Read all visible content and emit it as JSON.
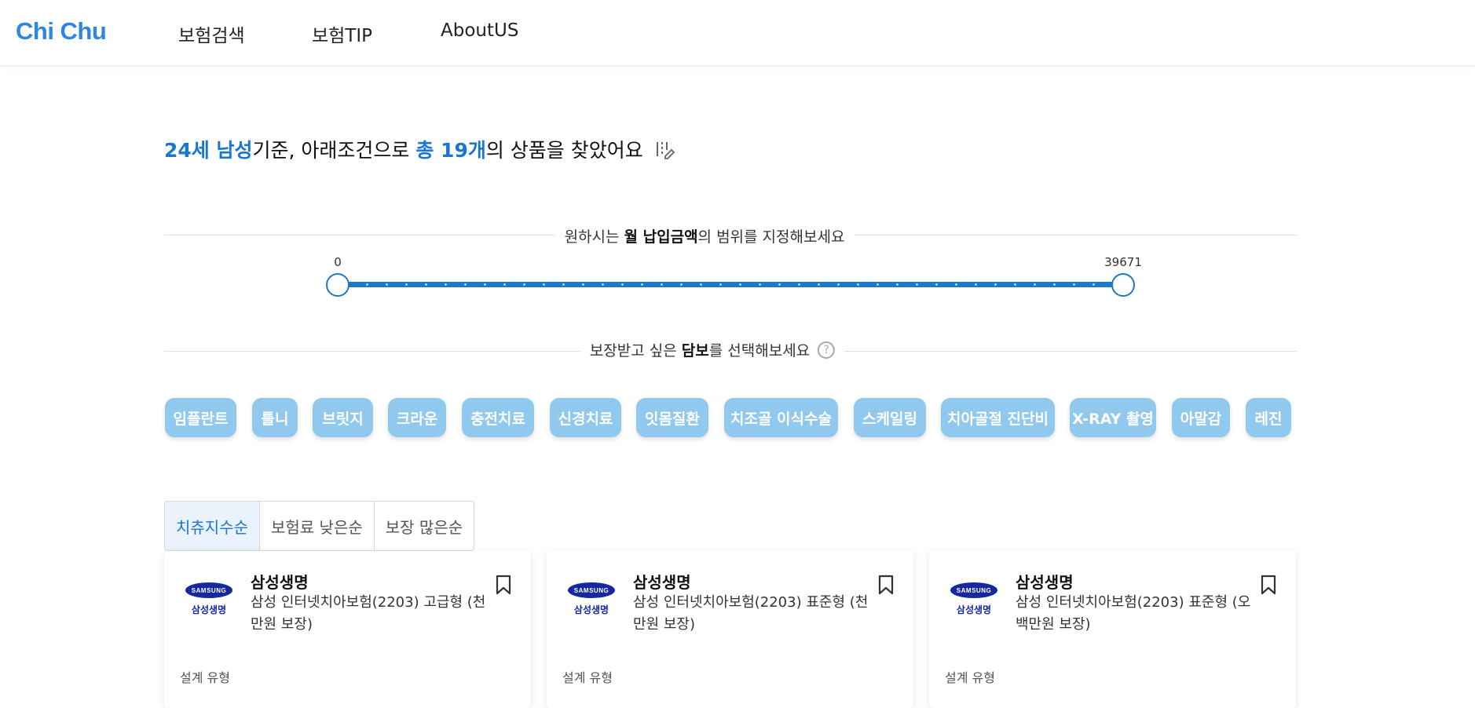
{
  "header": {
    "logo": "Chi Chu",
    "nav": [
      "보험검색",
      "보험TIP",
      "AboutUS"
    ]
  },
  "headline": {
    "age_gender": "24세 남성",
    "part1": "기준, 아래조건으로 ",
    "total": "총 19개",
    "part2": "의 상품을 찾았어요"
  },
  "price_range": {
    "label_pre": "원하시는 ",
    "label_bold": "월 납입금액",
    "label_post": "의 범위를 지정해보세요",
    "min": "0",
    "max": "39671"
  },
  "coverage": {
    "label_pre": "보장받고 싶은 ",
    "label_bold": "담보",
    "label_post": "를 선택해보세요",
    "chips": [
      "임플란트",
      "틀니",
      "브릿지",
      "크라운",
      "충전치료",
      "신경치료",
      "잇몸질환",
      "치조골 이식수술",
      "스케일링",
      "치아골절 진단비",
      "X-RAY 촬영",
      "아말감",
      "레진"
    ]
  },
  "sort": {
    "tabs": [
      "치츄지수순",
      "보험료 낮은순",
      "보장 많은순"
    ],
    "active": 0
  },
  "cards": [
    {
      "logo_text": "SAMSUNG",
      "logo_kor": "삼성생명",
      "company": "삼성생명",
      "product": "삼성 인터넷치아보험(2203) 고급형 (천만원 보장)",
      "type_label": "설계 유형"
    },
    {
      "logo_text": "SAMSUNG",
      "logo_kor": "삼성생명",
      "company": "삼성생명",
      "product": "삼성 인터넷치아보험(2203) 표준형 (천만원 보장)",
      "type_label": "설계 유형"
    },
    {
      "logo_text": "SAMSUNG",
      "logo_kor": "삼성생명",
      "company": "삼성생명",
      "product": "삼성 인터넷치아보험(2203) 표준형 (오백만원 보장)",
      "type_label": "설계 유형"
    }
  ],
  "colors": {
    "brand": "#2e86de",
    "accent": "#1976d2",
    "chip": "#90c8ee",
    "samsung": "#1428a0"
  }
}
